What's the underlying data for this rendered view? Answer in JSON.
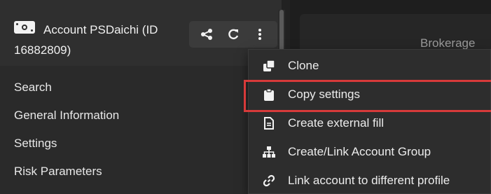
{
  "account": {
    "title": "Account PSDaichi (ID 16882809)",
    "icon": "account-card-icon"
  },
  "header_actions": [
    {
      "name": "share-icon"
    },
    {
      "name": "refresh-icon"
    },
    {
      "name": "more-vertical-icon"
    }
  ],
  "nav": {
    "items": [
      {
        "label": "Search"
      },
      {
        "label": "General Information"
      },
      {
        "label": "Settings"
      },
      {
        "label": "Risk Parameters"
      }
    ]
  },
  "right_panel": {
    "heading": "Brokerage"
  },
  "menu": {
    "items": [
      {
        "label": "Clone",
        "icon": "clone-icon"
      },
      {
        "label": "Copy settings",
        "icon": "clipboard-icon",
        "highlighted": true
      },
      {
        "label": "Create external fill",
        "icon": "document-icon"
      },
      {
        "label": "Create/Link Account Group",
        "icon": "sitemap-icon"
      },
      {
        "label": "Link account to different profile",
        "icon": "link-icon"
      }
    ]
  },
  "colors": {
    "background": "#222222",
    "panel": "#2a2a2a",
    "menu": "#2d2d2d",
    "highlight_border": "#d73a3a",
    "text": "#e8e8e8"
  }
}
